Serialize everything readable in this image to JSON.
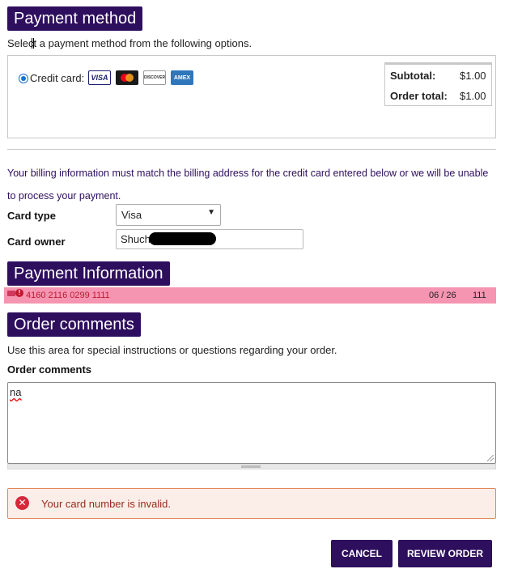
{
  "payment_method": {
    "title": "Payment method",
    "intro": "Select a payment method from the following options.",
    "option_label": "Credit card:",
    "card_icons": [
      "visa-icon",
      "mastercard-icon",
      "discover-icon",
      "amex-icon"
    ],
    "card_texts": {
      "visa": "VISA",
      "mastercard": "MasterCard",
      "discover": "DISCOVER",
      "amex": "AMEX"
    },
    "totals": {
      "subtotal_label": "Subtotal:",
      "subtotal_value": "$1.00",
      "order_total_label": "Order total:",
      "order_total_value": "$1.00"
    }
  },
  "billing": {
    "note": "Your billing information must match the billing address for the credit card entered below or we will be unable to process your payment.",
    "card_type_label": "Card type",
    "card_type_value": "Visa",
    "card_owner_label": "Card owner",
    "card_owner_value": "Shuch"
  },
  "payment_info": {
    "title": "Payment Information",
    "card_number": "4160 2116 0299 1111",
    "expiry": "06 / 26",
    "cvv": "111"
  },
  "order_comments": {
    "title": "Order comments",
    "intro": "Use this area for special instructions or questions regarding your order.",
    "label": "Order comments",
    "value": "na"
  },
  "alert": {
    "message": "Your card number is invalid."
  },
  "buttons": {
    "cancel": "CANCEL",
    "review": "REVIEW ORDER"
  },
  "colors": {
    "accent": "#2e0f5e",
    "error_bar": "#f595b1",
    "error_text": "#c01830",
    "alert_bg": "#fbeee9",
    "alert_border": "#e0875a"
  }
}
